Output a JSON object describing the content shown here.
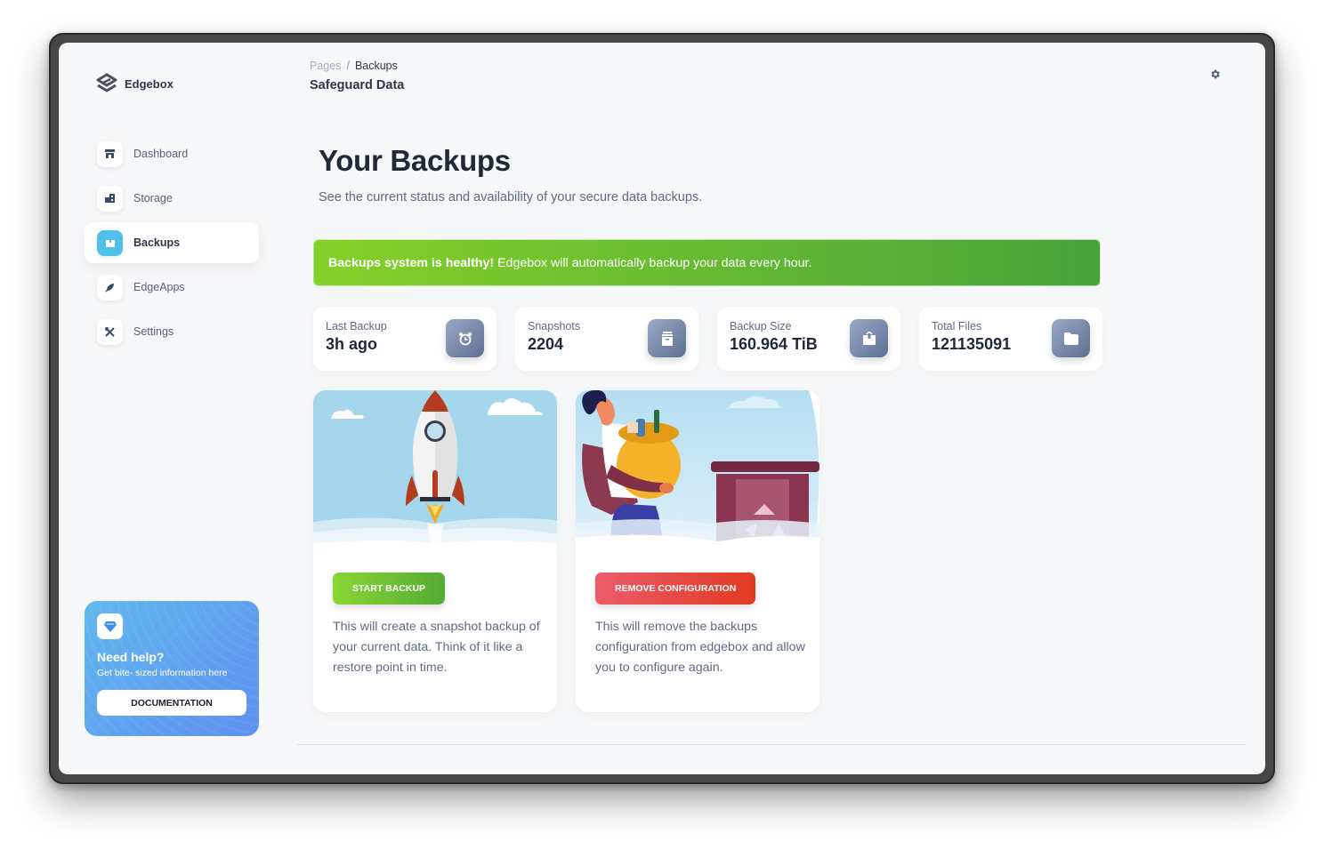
{
  "brand": {
    "name": "Edgebox",
    "logo_icon": "edgebox-logo-icon"
  },
  "sidebar": {
    "items": [
      {
        "label": "Dashboard",
        "icon": "store-icon",
        "active": false
      },
      {
        "label": "Storage",
        "icon": "building-icon",
        "active": false
      },
      {
        "label": "Backups",
        "icon": "box-icon",
        "active": true
      },
      {
        "label": "EdgeApps",
        "icon": "rocket-icon",
        "active": false
      },
      {
        "label": "Settings",
        "icon": "tools-icon",
        "active": false
      }
    ],
    "help": {
      "icon": "diamond-icon",
      "title": "Need help?",
      "subtitle": "Get bite- sized information here",
      "button_label": "DOCUMENTATION"
    }
  },
  "header": {
    "breadcrumb": {
      "parent": "Pages",
      "separator": "/",
      "current": "Backups"
    },
    "title": "Safeguard Data",
    "settings_icon": "gear-icon"
  },
  "main": {
    "title": "Your Backups",
    "subtitle": "See the current status and availability of your secure data backups.",
    "alert": {
      "bold": "Backups system is healthy!",
      "text": "Edgebox will automatically backup your data every hour.",
      "color_start": "#86d02a",
      "color_end": "#47a33a"
    },
    "stats": [
      {
        "label": "Last Backup",
        "value": "3h ago",
        "icon": "alarm-clock-icon"
      },
      {
        "label": "Snapshots",
        "value": "2204",
        "icon": "archive-icon"
      },
      {
        "label": "Backup Size",
        "value": "160.964 TiB",
        "icon": "box-open-icon"
      },
      {
        "label": "Total Files",
        "value": "121135091",
        "icon": "folder-icon"
      }
    ],
    "actions": [
      {
        "illustration": "rocket-launch-illustration",
        "button_label": "START BACKUP",
        "description": "This will create a snapshot backup of your current data. Think of it like a restore point in time.",
        "color": "#53ab32"
      },
      {
        "illustration": "recycling-person-illustration",
        "button_label": "REMOVE CONFIGURATION",
        "description": "This will remove the backups configuration from edgebox and allow you to configure again.",
        "color": "#e13a22"
      }
    ]
  }
}
